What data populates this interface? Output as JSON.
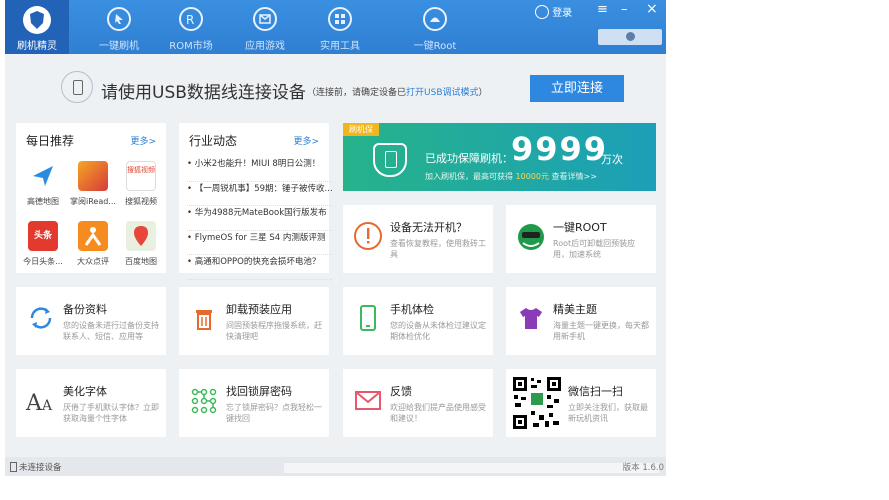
{
  "nav": {
    "brand": "刷机精灵",
    "items": [
      "一键刷机",
      "ROM市场",
      "应用游戏",
      "实用工具",
      "一键Root"
    ],
    "icons": [
      "cursor-icon",
      "rom-icon",
      "mail-icon",
      "apps-icon",
      "root-icon"
    ],
    "login": "登录",
    "menu_glyph": "≡",
    "minimize_glyph": "–",
    "close_glyph": "×"
  },
  "connect": {
    "title": "请使用USB数据线连接设备",
    "hint_pre": "（连接前，请确定设备已",
    "hint_link": "打开USB调试模式",
    "hint_post": "）",
    "button": "立即连接"
  },
  "daily": {
    "title": "每日推荐",
    "more": "更多>",
    "apps": [
      "高德地图",
      "掌阅iRead...",
      "搜狐视频",
      "今日头条...",
      "大众点评",
      "百度地图"
    ],
    "badge_toutiao": "头条",
    "badge_sohu": "搜狐视频"
  },
  "news": {
    "title": "行业动态",
    "more": "更多>",
    "items": [
      "小米2也能升！MIUI 8明日公测！",
      "【一周锐机事】59期：锤子被传收...",
      "华为4988元MateBook国行版发布",
      "FlymeOS for 三星 S4 内测版评测",
      "高通和OPPO的快充会损坏电池？"
    ]
  },
  "banner": {
    "tag": "刷机保",
    "line1": "已成功保障刷机：",
    "count": "9999",
    "unit": "万次",
    "line2_pre": "加入刷机保，最高可获得",
    "line2_amount": "10000元",
    "line2_post": "查看详情>>"
  },
  "cards": [
    {
      "title": "设备无法开机？",
      "desc": "查看恢复教程，使用救砖工具",
      "icon": "warning-icon"
    },
    {
      "title": "一键ROOT",
      "desc": "Root后可卸载回预装应用，加速系统",
      "icon": "root-android-icon"
    },
    {
      "title": "备份资料",
      "desc": "您的设备未进行过备份支持联系人、短信、应用等",
      "icon": "sync-icon"
    },
    {
      "title": "卸载预装应用",
      "desc": "间固预装程序拖慢系统，赶快清理吧",
      "icon": "trash-icon"
    },
    {
      "title": "手机体检",
      "desc": "您的设备从未体检过建议定期体检优化",
      "icon": "phone-check-icon"
    },
    {
      "title": "精美主题",
      "desc": "海量主题一键更换，每天都用新手机",
      "icon": "tshirt-icon"
    },
    {
      "title": "美化字体",
      "desc": "厌倦了手机默认字体？立即获取海量个性字体",
      "icon": "font-icon"
    },
    {
      "title": "找回锁屏密码",
      "desc": "忘了锁屏密码？点我轻松一键找回",
      "icon": "pattern-lock-icon"
    },
    {
      "title": "反馈",
      "desc": "欢迎给我们提产品使用感受和建议！",
      "icon": "mail-feedback-icon"
    },
    {
      "title": "微信扫一扫",
      "desc": "立即关注我们，获取最新玩机资讯",
      "icon": "qr-code-icon"
    }
  ],
  "status": {
    "device": "未连接设备",
    "version": "版本 1.6.0"
  },
  "colors": {
    "primary": "#2f7fd3",
    "banner_green": "#26b38a",
    "orange": "#f1b61d"
  }
}
